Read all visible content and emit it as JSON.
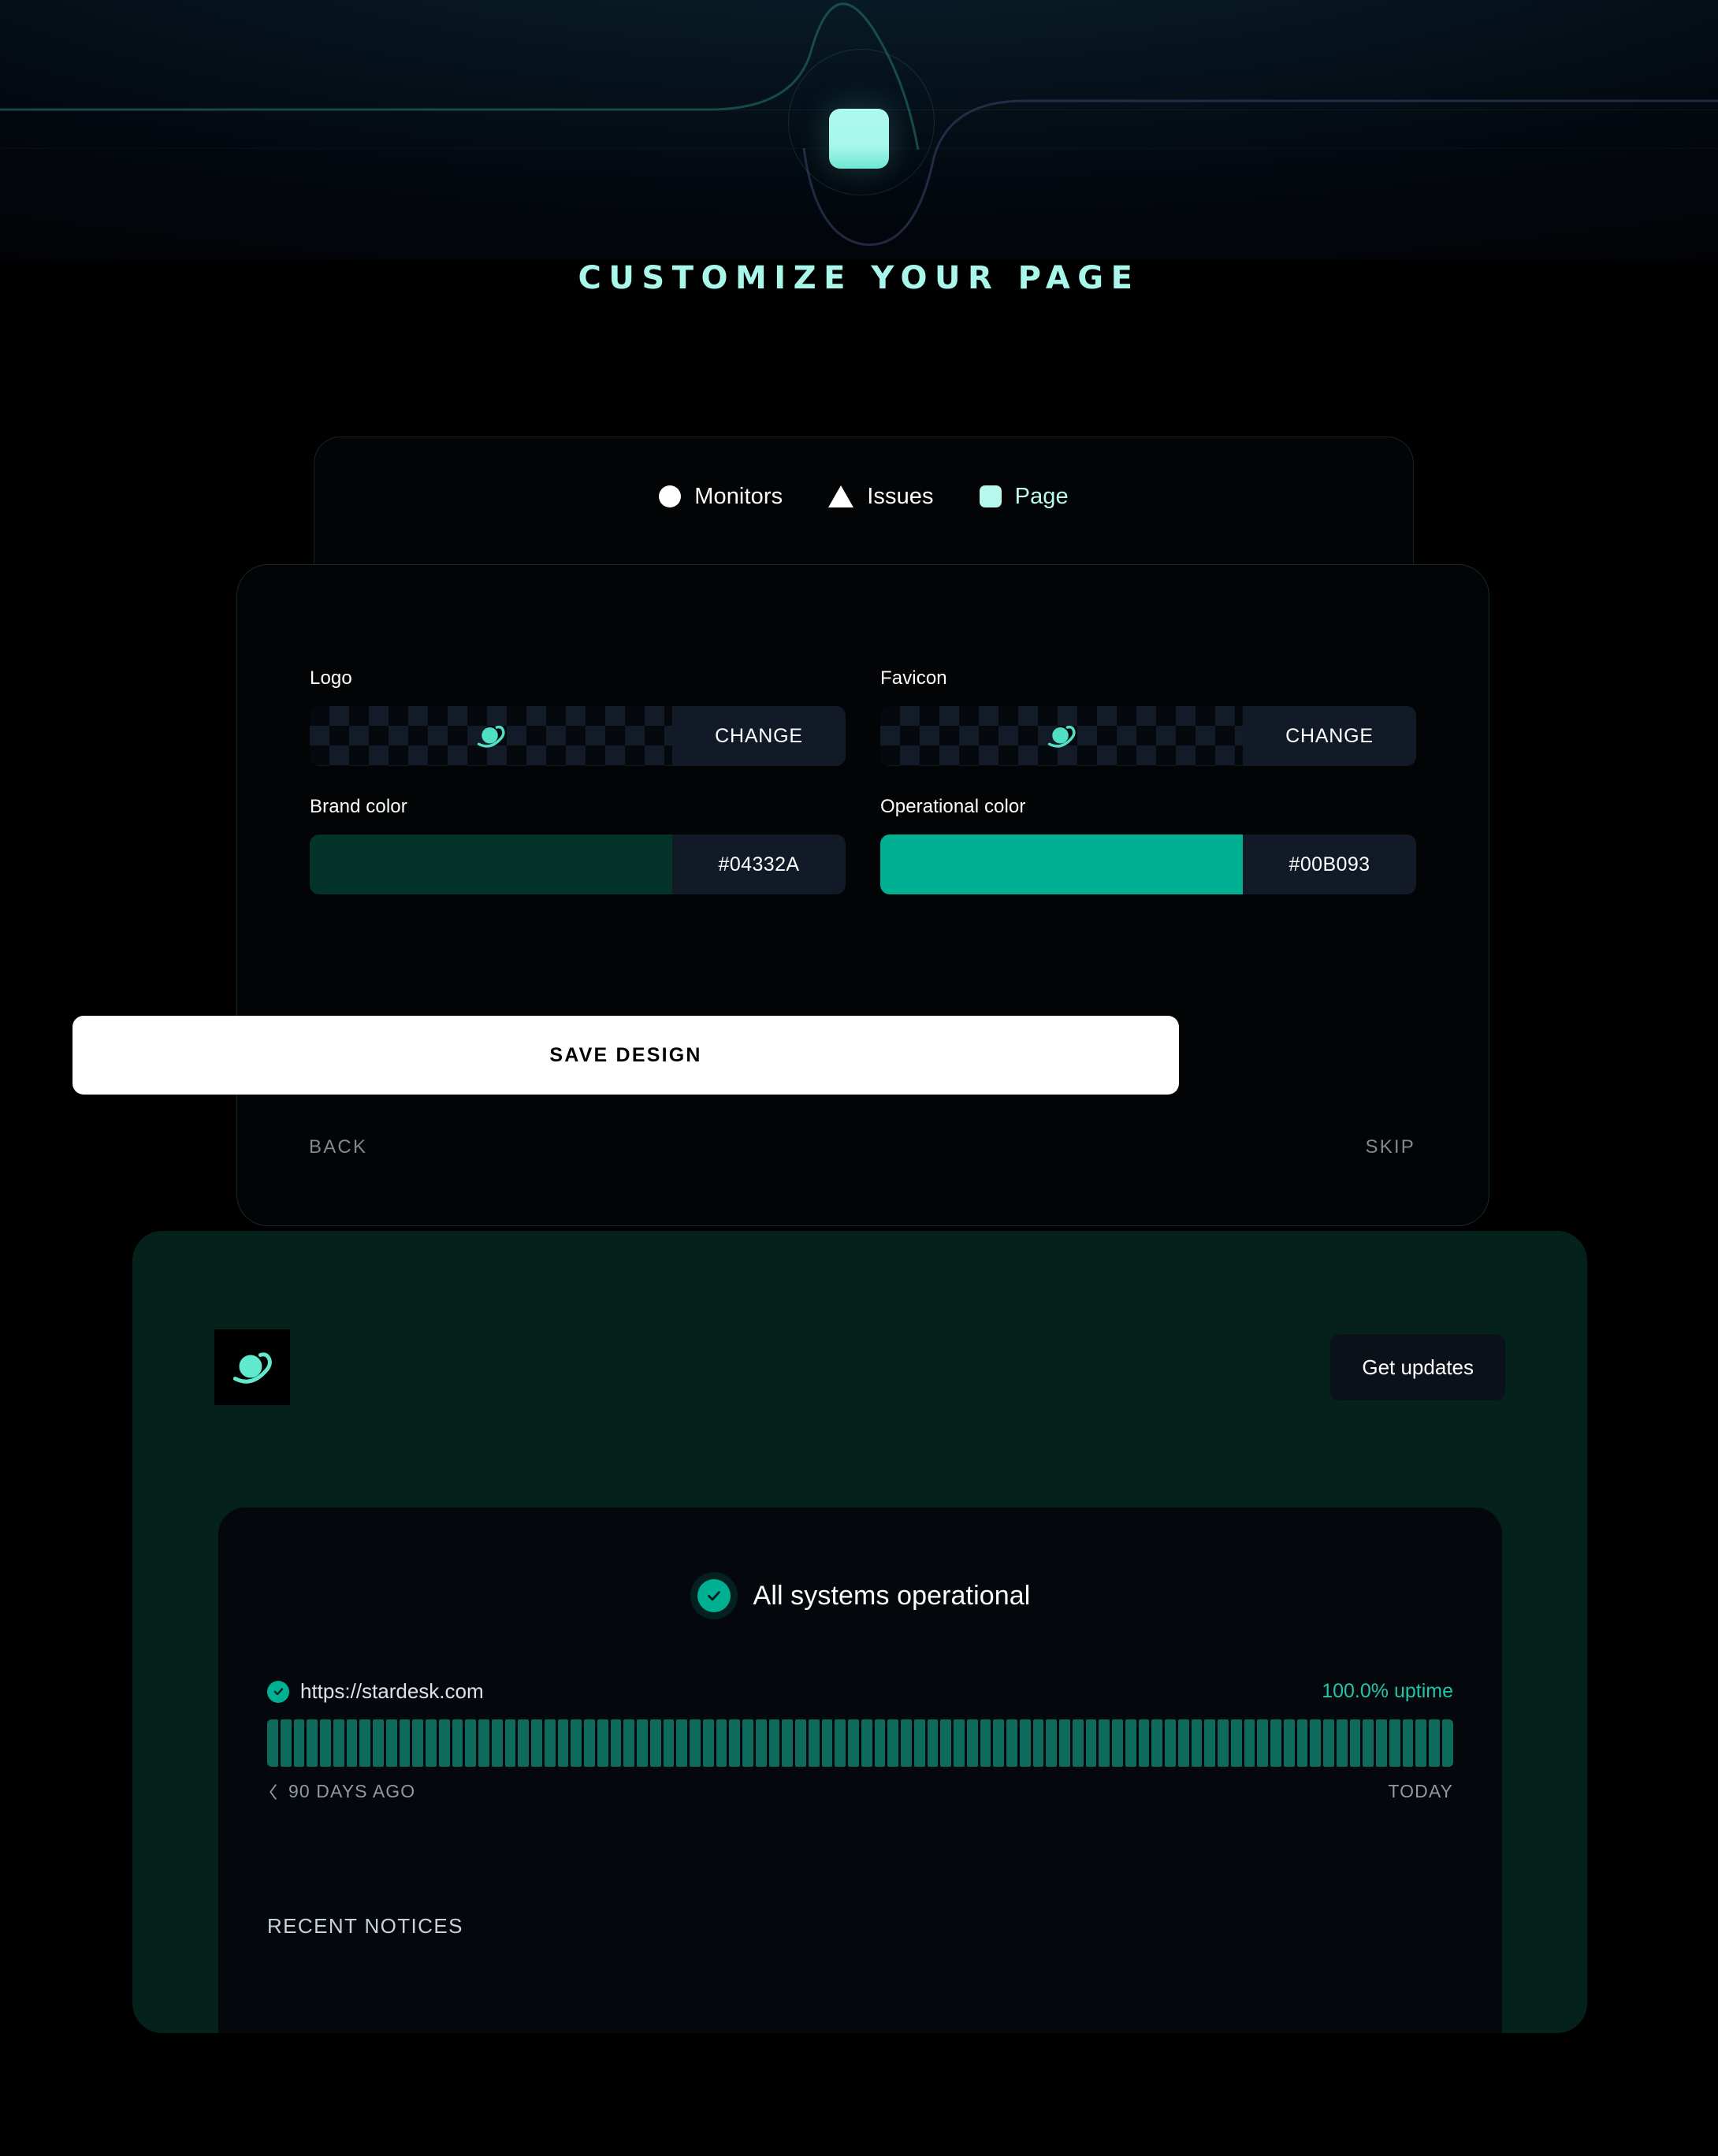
{
  "header": {
    "title": "CUSTOMIZE YOUR PAGE",
    "badge_icon": "rounded-square-logo-icon",
    "accent": "#a9f7ea"
  },
  "tabs": [
    {
      "label": "Monitors",
      "icon": "circle-icon",
      "active": false
    },
    {
      "label": "Issues",
      "icon": "triangle-icon",
      "active": false
    },
    {
      "label": "Page",
      "icon": "rounded-square-icon",
      "active": true
    }
  ],
  "form": {
    "logo": {
      "label": "Logo",
      "change_label": "CHANGE",
      "preview_icon": "planet-icon"
    },
    "favicon": {
      "label": "Favicon",
      "change_label": "CHANGE",
      "preview_icon": "planet-icon"
    },
    "brand_color": {
      "label": "Brand color",
      "value": "#04332A"
    },
    "operational_color": {
      "label": "Operational color",
      "value": "#00B093"
    },
    "save_label": "SAVE DESIGN",
    "back_label": "BACK",
    "skip_label": "SKIP"
  },
  "preview": {
    "brand_logo_icon": "planet-icon",
    "get_updates_label": "Get updates",
    "status": {
      "headline": "All systems operational",
      "status_icon": "check-circle-icon"
    },
    "monitor": {
      "name": "https://stardesk.com",
      "uptime": "100.0% uptime",
      "status_icon": "check-circle-icon",
      "segments": 90,
      "range_start": "90 DAYS AGO",
      "range_end": "TODAY",
      "range_prev_icon": "chevron-left-icon"
    },
    "recent_notices_label": "RECENT NOTICES"
  }
}
